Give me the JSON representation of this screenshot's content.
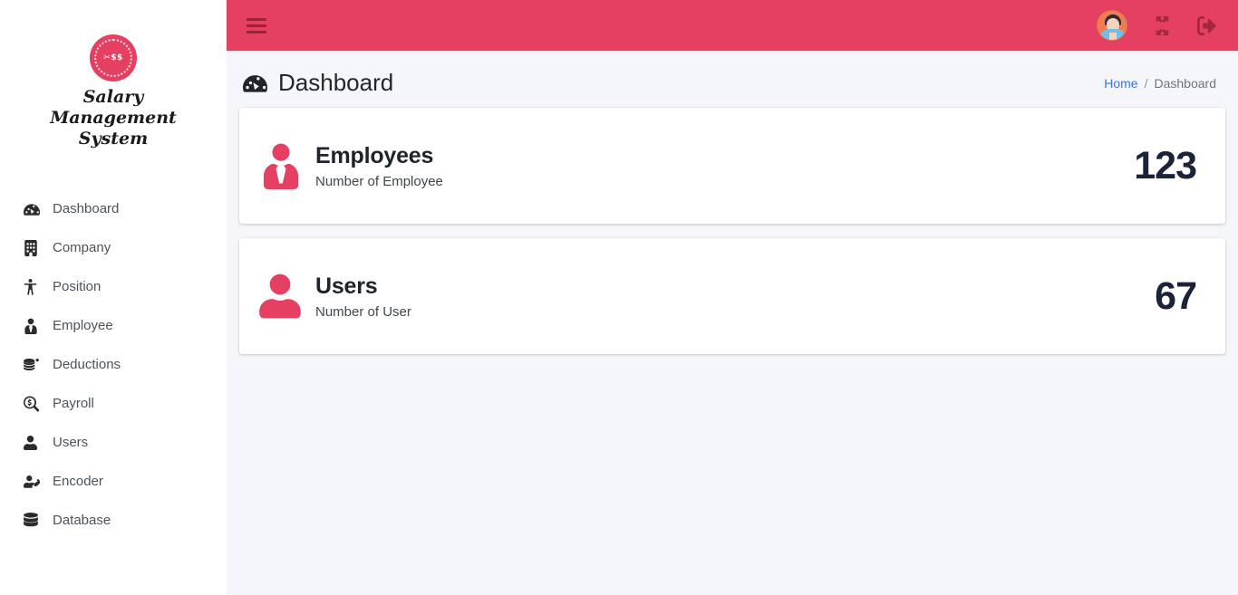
{
  "brand": {
    "logo_glyph": "✂$$",
    "name": "Salary Management System",
    "accent_color": "#e53f62"
  },
  "sidebar": {
    "items": [
      {
        "label": "Dashboard",
        "icon": "tachometer-icon"
      },
      {
        "label": "Company",
        "icon": "building-icon"
      },
      {
        "label": "Position",
        "icon": "child-icon"
      },
      {
        "label": "Employee",
        "icon": "user-tie-icon"
      },
      {
        "label": "Deductions",
        "icon": "coins-icon"
      },
      {
        "label": "Payroll",
        "icon": "search-dollar-icon"
      },
      {
        "label": "Users",
        "icon": "user-icon"
      },
      {
        "label": "Encoder",
        "icon": "user-edit-icon"
      },
      {
        "label": "Database",
        "icon": "database-icon"
      }
    ]
  },
  "topbar": {
    "menu_toggle": "hamburger-icon",
    "avatar": "user-avatar",
    "fullscreen": "expand-arrows-icon",
    "logout": "sign-out-icon",
    "background_color": "#e53f62"
  },
  "header": {
    "title": "Dashboard",
    "title_icon": "tachometer-icon",
    "breadcrumb": {
      "home": "Home",
      "separator": "/",
      "current": "Dashboard"
    }
  },
  "cards": [
    {
      "title": "Employees",
      "subtitle": "Number of Employee",
      "value": "123",
      "icon": "user-tie-icon"
    },
    {
      "title": "Users",
      "subtitle": "Number of User",
      "value": "67",
      "icon": "user-icon"
    }
  ]
}
